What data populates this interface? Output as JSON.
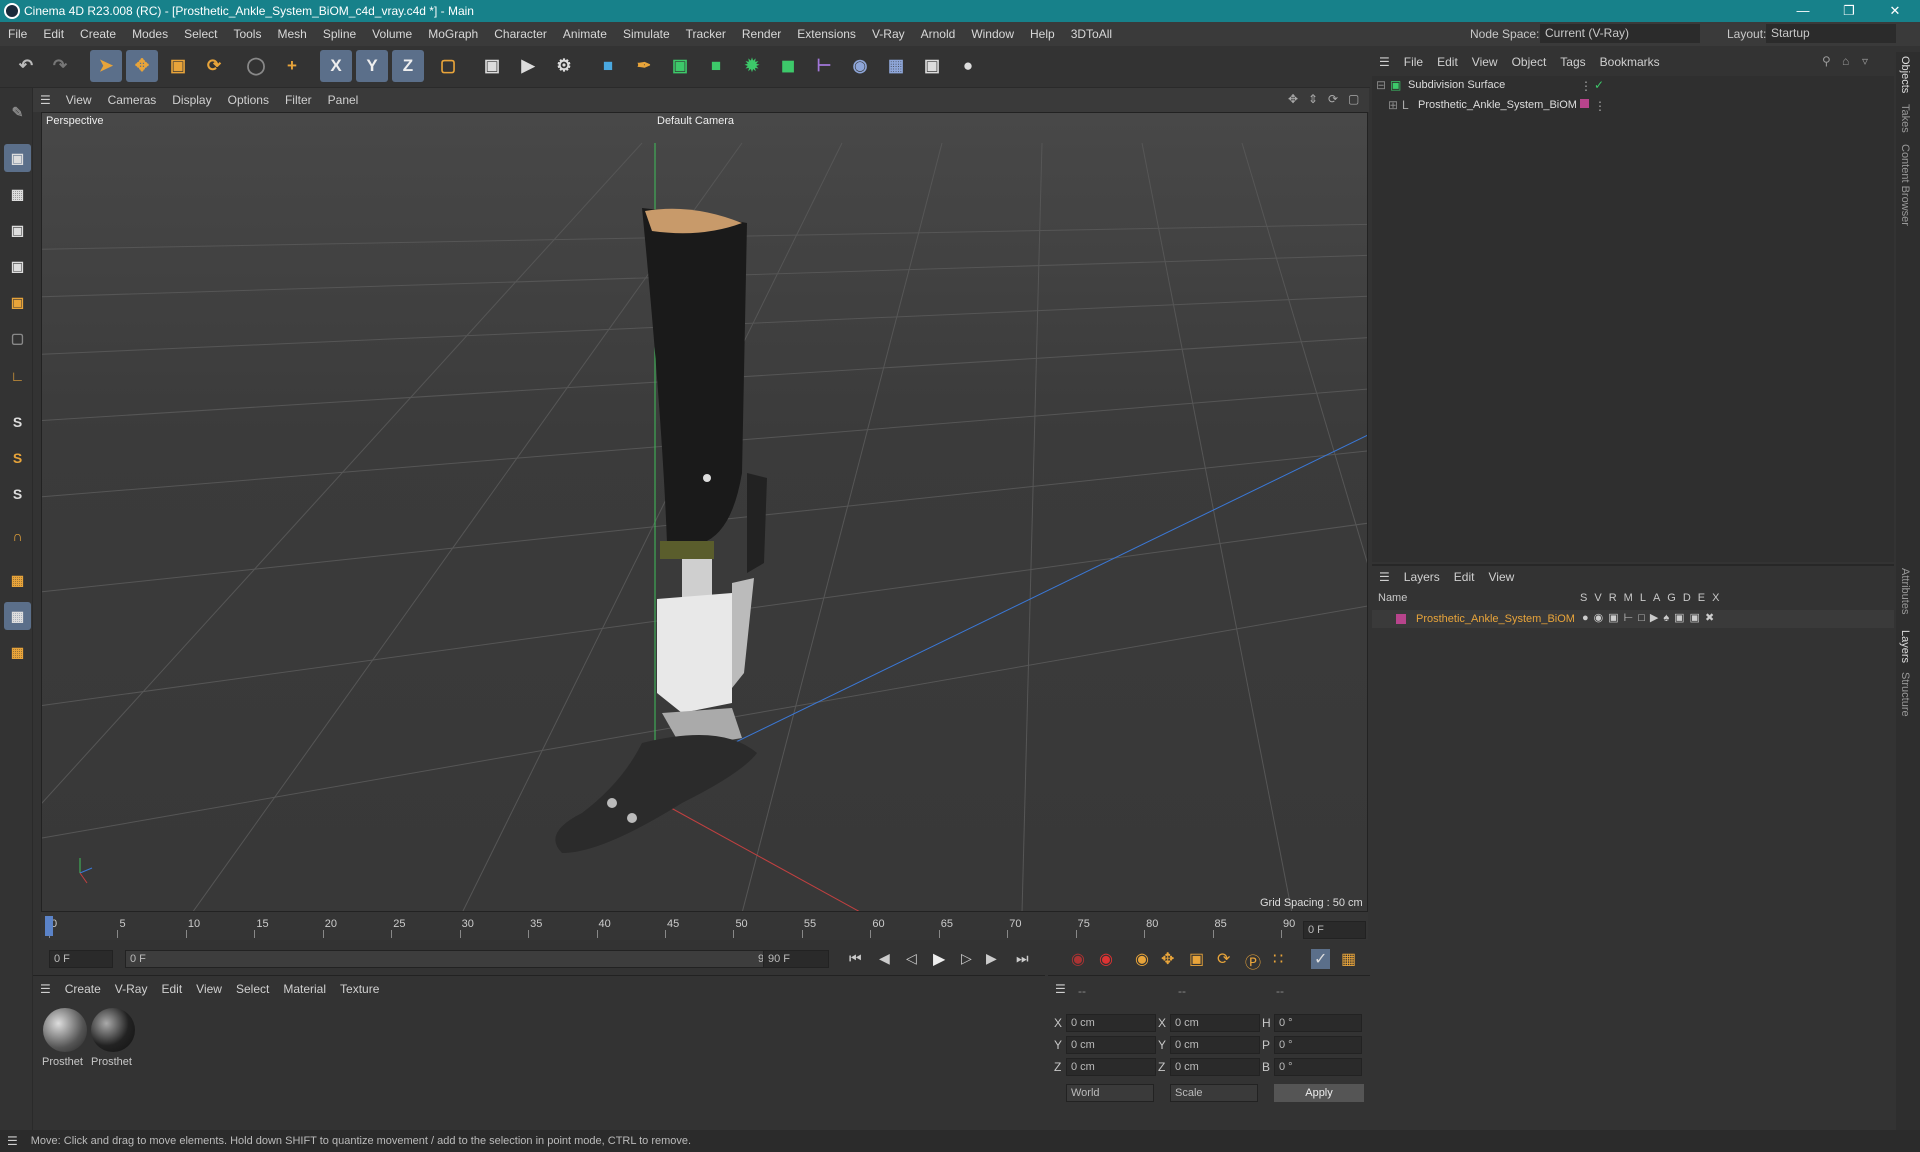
{
  "app": {
    "title": "Cinema 4D R23.008 (RC) - [Prosthetic_Ankle_System_BiOM_c4d_vray.c4d *] - Main"
  },
  "menu": [
    "File",
    "Edit",
    "Create",
    "Modes",
    "Select",
    "Tools",
    "Mesh",
    "Spline",
    "Volume",
    "MoGraph",
    "Character",
    "Animate",
    "Simulate",
    "Tracker",
    "Render",
    "Extensions",
    "V-Ray",
    "Arnold",
    "Window",
    "Help",
    "3DToAll"
  ],
  "nodespace": {
    "label": "Node Space:",
    "value": "Current (V-Ray)"
  },
  "layout": {
    "label": "Layout:",
    "value": "Startup"
  },
  "viewport": {
    "menu": [
      "View",
      "Cameras",
      "Display",
      "Options",
      "Filter",
      "Panel"
    ],
    "name": "Perspective",
    "camera": "Default Camera",
    "grid_spacing": "Grid Spacing : 50 cm"
  },
  "timeline": {
    "ticks": [
      "0",
      "5",
      "10",
      "15",
      "20",
      "25",
      "30",
      "35",
      "40",
      "45",
      "50",
      "55",
      "60",
      "65",
      "70",
      "75",
      "80",
      "85",
      "90"
    ],
    "current": "0 F"
  },
  "transport": {
    "start": "0 F",
    "range_start": "0 F",
    "range_end": "90 F",
    "end": "90 F"
  },
  "materials": {
    "menu": [
      "Create",
      "V-Ray",
      "Edit",
      "View",
      "Select",
      "Material",
      "Texture"
    ],
    "items": [
      {
        "name": "Prosthet"
      },
      {
        "name": "Prosthet"
      }
    ]
  },
  "coords": {
    "headers": [
      "--",
      "--",
      "--"
    ],
    "rows": [
      {
        "a": "X",
        "v1": "0 cm",
        "b": "X",
        "v2": "0 cm",
        "c": "H",
        "v3": "0 °"
      },
      {
        "a": "Y",
        "v1": "0 cm",
        "b": "Y",
        "v2": "0 cm",
        "c": "P",
        "v3": "0 °"
      },
      {
        "a": "Z",
        "v1": "0 cm",
        "b": "Z",
        "v2": "0 cm",
        "c": "B",
        "v3": "0 °"
      }
    ],
    "world": "World",
    "scale": "Scale",
    "apply": "Apply"
  },
  "objects": {
    "menu": [
      "File",
      "Edit",
      "View",
      "Object",
      "Tags",
      "Bookmarks"
    ],
    "items": [
      {
        "name": "Subdivision Surface"
      },
      {
        "name": "Prosthetic_Ankle_System_BiOM"
      }
    ]
  },
  "layers": {
    "menu": [
      "Layers",
      "Edit",
      "View"
    ],
    "header_name": "Name",
    "cols": [
      "S",
      "V",
      "R",
      "M",
      "L",
      "A",
      "G",
      "D",
      "E",
      "X"
    ],
    "items": [
      {
        "name": "Prosthetic_Ankle_System_BiOM"
      }
    ]
  },
  "side_tabs": [
    "Objects",
    "Takes",
    "Content Browser",
    "Attributes",
    "Layers",
    "Structure"
  ],
  "status": "Move: Click and drag to move elements. Hold down SHIFT to quantize movement / add to the selection in point mode, CTRL to remove.",
  "colors": {
    "accent": "#17818a",
    "layer": "#b8448c",
    "select": "#5b6f8a"
  }
}
